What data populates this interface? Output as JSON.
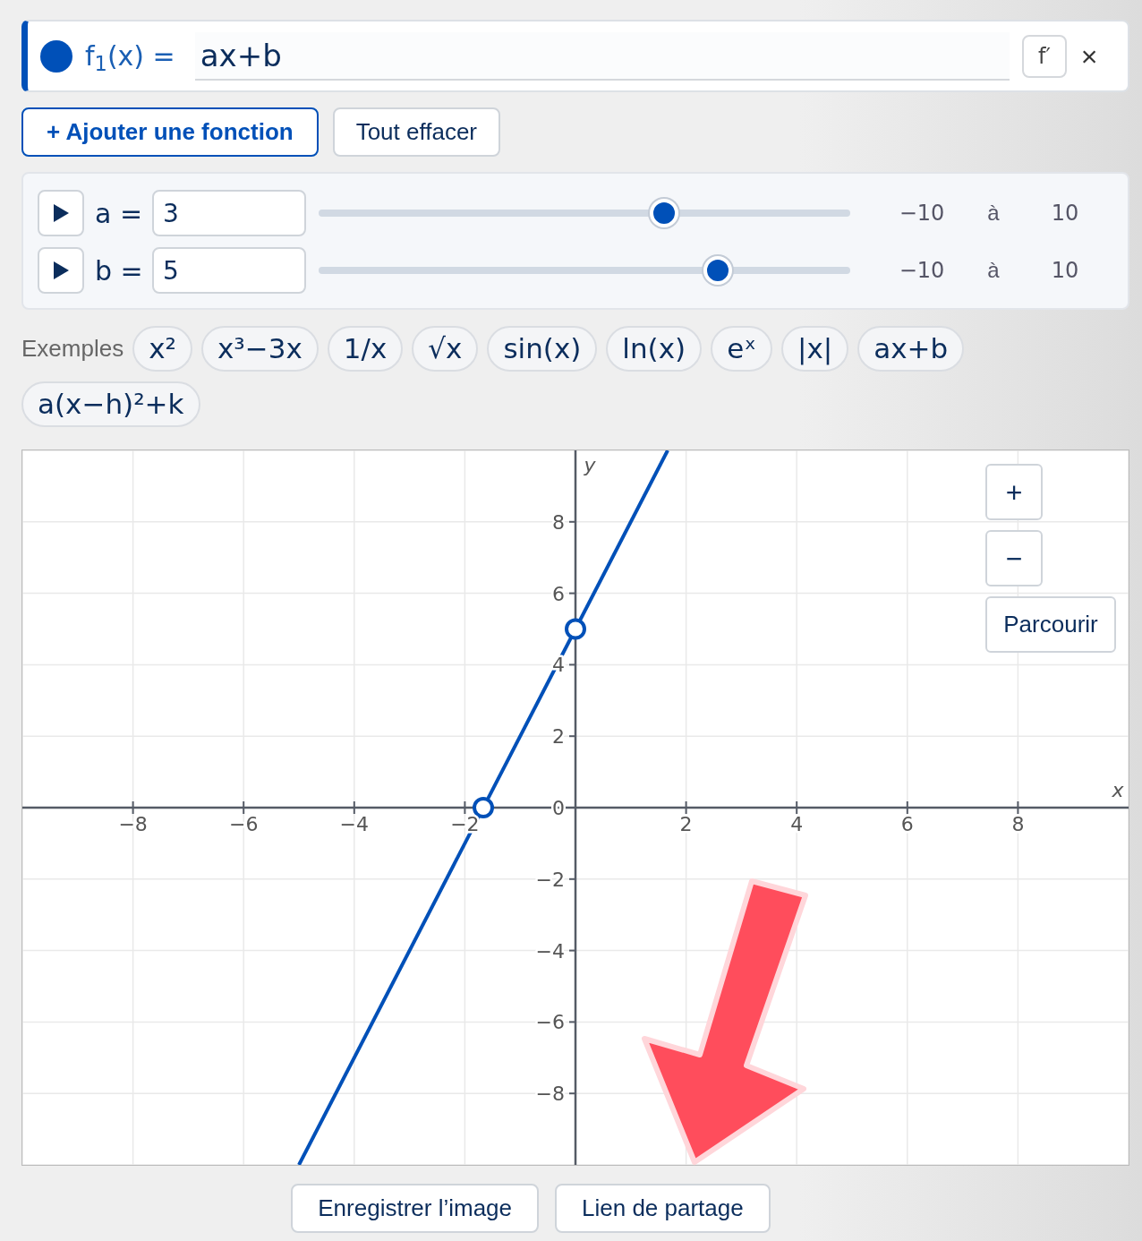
{
  "function": {
    "color": "#0050b8",
    "label": "f$_{1}$(x) =",
    "expression": "ax+b",
    "derivative_button": "f′",
    "close_button": "×"
  },
  "actions": [
    "+ Ajouter une fonction",
    "Tout effacer"
  ],
  "parameters": [
    {
      "name": "a =",
      "value": "3",
      "level": 0.65,
      "min": "−10",
      "to": "à",
      "max": "10"
    },
    {
      "name": "b =",
      "value": "5",
      "level": 0.75,
      "min": "−10",
      "to": "à",
      "max": "10"
    }
  ],
  "examples": {
    "label": "Exemples",
    "items": [
      "x²",
      "x³−3x",
      "1/x",
      "√x",
      "sin(x)",
      "ln(x)",
      "eˣ",
      "|x|",
      "ax+b",
      "a(x−h)²+k"
    ]
  },
  "graph": {
    "zoom_in": "+",
    "zoom_out": "−",
    "browse": "Parcourir",
    "chart_data": {
      "type": "line",
      "xlabel": "x",
      "ylabel": "y",
      "x": [
        -5,
        1.667
      ],
      "series": [
        {
          "color": "#0050b8",
          "values": [
            -10,
            10
          ]
        }
      ],
      "xlim": [
        -10,
        10
      ],
      "ylim": [
        -10,
        10
      ],
      "xticks": [
        {
          "value": -8,
          "label": "−8"
        },
        {
          "value": -6,
          "label": "−6"
        },
        {
          "value": -4,
          "label": "−4"
        },
        {
          "value": -2,
          "label": "−2"
        },
        {
          "value": 2,
          "label": "2"
        },
        {
          "value": 4,
          "label": "4"
        },
        {
          "value": 6,
          "label": "6"
        },
        {
          "value": 8,
          "label": "8"
        }
      ],
      "yticks": [
        {
          "value": 0,
          "label": "0"
        },
        {
          "value": -8,
          "label": "−8"
        },
        {
          "value": -6,
          "label": "−6"
        },
        {
          "value": -4,
          "label": "−4"
        },
        {
          "value": -2,
          "label": "−2"
        },
        {
          "value": 2,
          "label": "2"
        },
        {
          "value": 4,
          "label": "4"
        },
        {
          "value": 6,
          "label": "6"
        },
        {
          "value": 8,
          "label": "8"
        }
      ],
      "grid": true
    }
  },
  "footer_buttons": [
    "Enregistrer l’image",
    "Lien de partage"
  ]
}
